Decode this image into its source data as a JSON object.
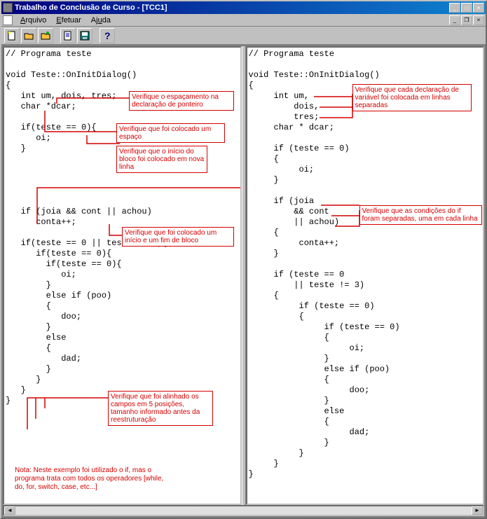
{
  "window": {
    "title": "Trabalho de Conclusão de Curso - [TCC1]"
  },
  "menu": {
    "file": "Arquivo",
    "exec": "Efetuar",
    "help": "Ajuda"
  },
  "toolbar": {
    "new": "new-doc",
    "open": "open-folder",
    "open2": "open-folder",
    "doc": "document",
    "save": "save",
    "help": "help"
  },
  "left_code": "// Programa teste\n\nvoid Teste::OnInitDialog()\n{\n   int um, dois, tres;\n   char *dcar;\n\n   if(teste == 0){\n      oi;\n   }\n\n\n\n\n\n   if (joia && cont || achou)\n      conta++;\n\n   if(teste == 0 || teste != 3){\n      if(teste == 0){\n        if(teste == 0){\n           oi;\n        }\n        else if (poo)\n        {\n           doo;\n        }\n        else\n        {\n           dad;\n        }\n      }\n   }\n}",
  "right_code": "// Programa teste\n\nvoid Teste::OnInitDialog()\n{\n     int um,\n         dois,\n         tres;\n     char * dcar;\n\n     if (teste == 0)\n     {\n          oi;\n     }\n\n     if (joia\n         && cont\n         || achou)\n     {\n          conta++;\n     }\n\n     if (teste == 0\n         || teste != 3)\n     {\n          if (teste == 0)\n          {\n               if (teste == 0)\n               {\n                    oi;\n               }\n               else if (poo)\n               {\n                    doo;\n               }\n               else\n               {\n                    dad;\n               }\n          }\n     }\n}",
  "annotations": {
    "a1": "Verifique o espaçamento na declaração de ponteiro",
    "a2": "Verifique que foi colocado um espaço",
    "a3": "Verifique que o início do bloco foi colocado em nova linha",
    "a4": "Verifique que cada declaração de variável foi colocada em linhas separadas",
    "a5": "Verifique que foi colocado um início e um fim de bloco",
    "a6": "Verifique que as condições do if foram separadas, uma em cada linha",
    "a7": "Verifique que foi alinhado os campos em 5 posições, tamanho informado antes da reestruturação",
    "note": "Nota: Neste exemplo foi utilizado o if, mas o programa trata com todos os operadores [while, do, for, switch, case, etc...]"
  },
  "colors": {
    "annotation": "#d40000",
    "titlebar_start": "#000080",
    "titlebar_end": "#1084d0"
  }
}
